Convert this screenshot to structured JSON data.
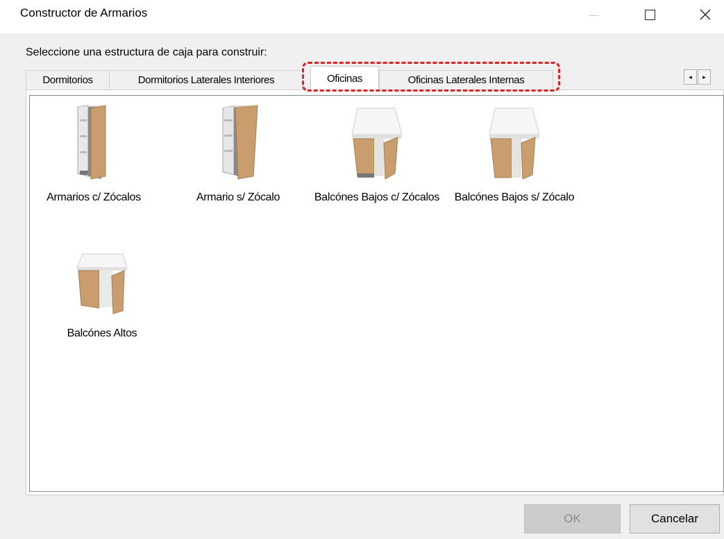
{
  "window": {
    "title": "Constructor de Armarios",
    "controls": [
      "minimize",
      "maximize",
      "close"
    ]
  },
  "prompt": "Seleccione una estructura de caja para construir:",
  "tabs": [
    {
      "label": "Dormitorios",
      "active": false
    },
    {
      "label": "Dormitorios Laterales Interiores",
      "active": false
    },
    {
      "label": "Oficinas",
      "active": true
    },
    {
      "label": "Oficinas Laterales Internas",
      "active": false
    }
  ],
  "tab_scroll": {
    "left_icon": "◂",
    "right_icon": "▸"
  },
  "highlight": {
    "color": "#e01f1f",
    "style": "dashed"
  },
  "items": [
    {
      "label": "Armarios c/ Zócalos",
      "icon": "tall-cabinet-plinth-icon"
    },
    {
      "label": "Armario s/ Zócalo",
      "icon": "tall-cabinet-icon"
    },
    {
      "label": "Balcónes Bajos c/ Zócalos",
      "icon": "base-cabinet-plinth-icon"
    },
    {
      "label": "Balcónes Bajos s/ Zócalo",
      "icon": "base-cabinet-icon"
    },
    {
      "label": "Balcónes Altos",
      "icon": "wall-cabinet-icon"
    }
  ],
  "buttons": {
    "ok": {
      "label": "OK",
      "enabled": false
    },
    "cancel": {
      "label": "Cancelar",
      "enabled": true
    }
  },
  "colors": {
    "wood": "#c99d6e",
    "wood_dark": "#a67b4d",
    "panel_gray": "#8f8f8f",
    "top_white": "#f6f6f6"
  }
}
